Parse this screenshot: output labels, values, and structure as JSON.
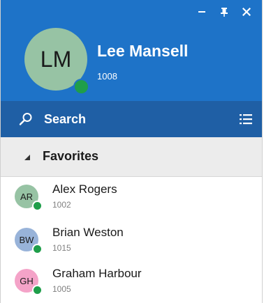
{
  "window_controls": {
    "minimize_glyph": "–",
    "pin_glyph": "📌",
    "close_glyph": "✕"
  },
  "user": {
    "initials": "LM",
    "name": "Lee Mansell",
    "extension": "1008",
    "avatar_color": "#97c3a4",
    "presence_color": "#1f9e4a",
    "presence": "available"
  },
  "search": {
    "label": "Search",
    "icon": "search-icon",
    "menu_icon": "list-menu-icon"
  },
  "favorites": {
    "title": "Favorites",
    "collapse_icon": "triangle-collapse-icon",
    "contacts": [
      {
        "initials": "AR",
        "name": "Alex Rogers",
        "extension": "1002",
        "avatar_color": "#97c3a4",
        "presence": "available"
      },
      {
        "initials": "BW",
        "name": "Brian Weston",
        "extension": "1015",
        "avatar_color": "#98b3d9",
        "presence": "available"
      },
      {
        "initials": "GH",
        "name": "Graham Harbour",
        "extension": "1005",
        "avatar_color": "#f4a3c8",
        "presence": "available"
      }
    ]
  },
  "colors": {
    "header_blue": "#1e73c8",
    "search_blue": "#1f5fa5",
    "section_gray": "#ececec",
    "presence_green": "#1f9e4a"
  }
}
